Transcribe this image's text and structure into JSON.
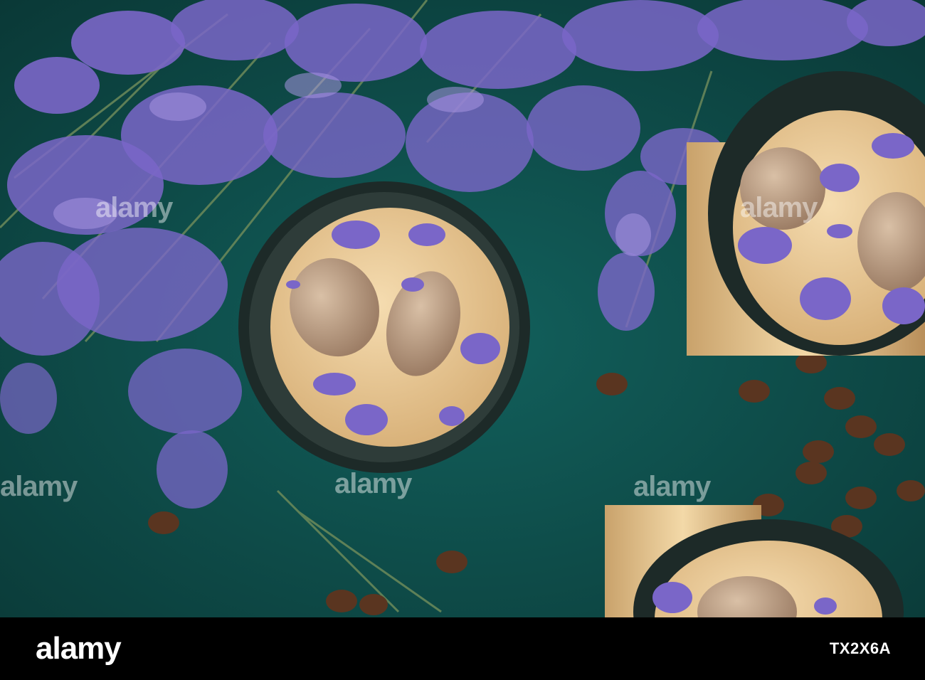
{
  "photo": {
    "subject": "iced-coffee-with-lavender",
    "colors": {
      "background": "#0f4a49",
      "lavender": "#7a66c8",
      "coffee": "#e9c895",
      "glass_rim": "#1d2a28"
    }
  },
  "watermark": {
    "text": "alamy"
  },
  "footer": {
    "brand": "alamy",
    "image_id": "TX2X6A"
  }
}
